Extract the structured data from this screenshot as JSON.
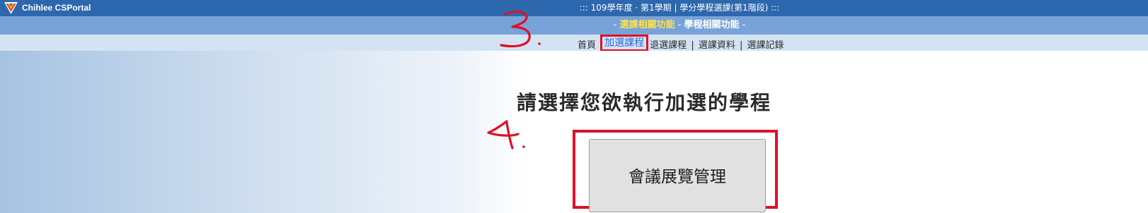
{
  "app": {
    "brand": "Chihlee CSPortal",
    "session_title": "::: 109學年度 · 第1學期 | 學分學程選課(第1階段) :::"
  },
  "function_bar": {
    "prefix": "- ",
    "active_label": "選課相關功能",
    "separator": " - ",
    "other_label": "學程相關功能",
    "suffix": " -"
  },
  "nav": {
    "items": [
      {
        "label": "首頁"
      },
      {
        "label": "加選課程"
      },
      {
        "label": "退選課程"
      },
      {
        "label": "選課資料"
      },
      {
        "label": "選課記錄"
      }
    ],
    "separator": "|"
  },
  "main": {
    "heading": "請選擇您欲執行加選的學程",
    "program_button": "會議展覽管理"
  },
  "annotations": {
    "step3": "3.",
    "step4": "4."
  },
  "colors": {
    "header_bg": "#2d67ad",
    "function_bar_bg": "#78a3d9",
    "nav_bg": "#d3e3f3",
    "active_function": "#ffe24a",
    "active_nav": "#2a6bd8",
    "annotation_red": "#e01024"
  }
}
